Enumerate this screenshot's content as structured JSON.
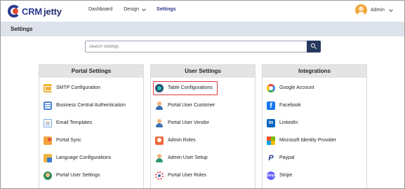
{
  "brand": {
    "part1": "CRM",
    "part2": "jetty"
  },
  "nav": {
    "items": [
      {
        "label": "Dashboard",
        "active": false,
        "dropdown": false
      },
      {
        "label": "Design",
        "active": false,
        "dropdown": true
      },
      {
        "label": "Settings",
        "active": true,
        "dropdown": false
      }
    ]
  },
  "user": {
    "name": "Admin"
  },
  "page": {
    "title": "Settings"
  },
  "search": {
    "placeholder": "Search Settings",
    "value": ""
  },
  "cards": {
    "portal": {
      "title": "Portal Settings",
      "items": [
        {
          "label": "SMTP Configuration",
          "icon": "mail-icon"
        },
        {
          "label": "Business Central Authentication",
          "icon": "business-central-icon"
        },
        {
          "label": "Email Templates",
          "icon": "email-template-icon"
        },
        {
          "label": "Portal Sync",
          "icon": "sync-icon"
        },
        {
          "label": "Language Configurations",
          "icon": "language-icon"
        },
        {
          "label": "Portal User Settings",
          "icon": "user-settings-icon"
        }
      ]
    },
    "user": {
      "title": "User Settings",
      "items": [
        {
          "label": "Table Configurations",
          "icon": "table-config-icon",
          "highlighted": true
        },
        {
          "label": "Portal User Customer",
          "icon": "person-icon"
        },
        {
          "label": "Portal User Vendor",
          "icon": "person-icon"
        },
        {
          "label": "Admin Roles",
          "icon": "roles-icon"
        },
        {
          "label": "Admin User Setup",
          "icon": "user-setup-icon"
        },
        {
          "label": "Portal User Roles",
          "icon": "portal-roles-icon"
        }
      ]
    },
    "integrations": {
      "title": "Integrations",
      "items": [
        {
          "label": "Google Account",
          "icon": "google-icon"
        },
        {
          "label": "Facebook",
          "icon": "facebook-icon",
          "glyph": "f"
        },
        {
          "label": "LinkedIn",
          "icon": "linkedin-icon",
          "glyph": "in"
        },
        {
          "label": "Microsoft Identity Provider",
          "icon": "microsoft-icon"
        },
        {
          "label": "Paypal",
          "icon": "paypal-icon",
          "glyph": "P"
        },
        {
          "label": "Stripe",
          "icon": "stripe-icon",
          "glyph": "stripe"
        }
      ]
    }
  },
  "colors": {
    "brand_navy": "#2b3a8f",
    "search_button": "#26395f",
    "title_bar": "#dde2eb",
    "highlight": "#e03a3a"
  }
}
